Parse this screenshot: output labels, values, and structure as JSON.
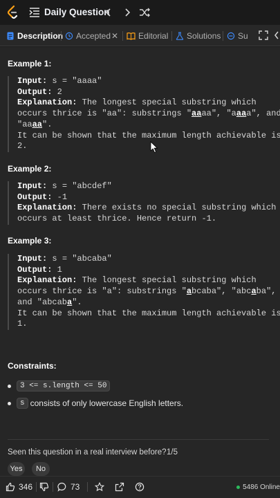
{
  "header": {
    "title": "Daily Question",
    "icons": [
      "leetcode-logo",
      "problem-list-icon",
      "prev-icon",
      "next-icon",
      "shuffle-icon"
    ]
  },
  "tabs": [
    {
      "label": "Description",
      "icon": "description-icon",
      "active": true
    },
    {
      "label": "Accepted",
      "icon": "history-icon",
      "active": false
    },
    {
      "label": "Editorial",
      "icon": "book-icon",
      "active": false
    },
    {
      "label": "Solutions",
      "icon": "flask-icon",
      "active": false
    },
    {
      "label": "Su",
      "icon": "submissions-icon",
      "active": false
    }
  ],
  "examples": [
    {
      "title": "Example 1:",
      "input_label": "Input:",
      "input": " s = \"aaaa\"",
      "output_label": "Output:",
      "output": " 2",
      "expl_label": "Explanation:",
      "expl_lines": [
        [
          "The longest special substring which"
        ],
        [
          "occurs thrice is \"aa\": substrings \"",
          "aa",
          "aa\", \"a",
          "aa",
          "a\", and"
        ],
        [
          "\"aa",
          "aa",
          "\"."
        ],
        [
          "It can be shown that the maximum length achievable is"
        ],
        [
          "2."
        ]
      ]
    },
    {
      "title": "Example 2:",
      "input_label": "Input:",
      "input": " s = \"abcdef\"",
      "output_label": "Output:",
      "output": " -1",
      "expl_label": "Explanation:",
      "expl_lines": [
        [
          "There exists no special substring which"
        ],
        [
          "occurs at least thrice. Hence return -1."
        ]
      ]
    },
    {
      "title": "Example 3:",
      "input_label": "Input:",
      "input": " s = \"abcaba\"",
      "output_label": "Output:",
      "output": " 1",
      "expl_label": "Explanation:",
      "expl_lines": [
        [
          "The longest special substring which"
        ],
        [
          "occurs thrice is \"a\": substrings \"",
          "a",
          "bcaba\", \"abc",
          "a",
          "ba\","
        ],
        [
          "and \"abcab",
          "a",
          "\"."
        ],
        [
          "It can be shown that the maximum length achievable is"
        ],
        [
          "1."
        ]
      ]
    }
  ],
  "constraints": {
    "title": "Constraints:",
    "items": [
      {
        "code": "3 <= s.length <= 50",
        "text": ""
      },
      {
        "code": "s",
        "text": "consists of only lowercase English letters."
      }
    ]
  },
  "interview": {
    "question": "Seen this question in a real interview before?",
    "count": "1/5",
    "yes": "Yes",
    "no": "No"
  },
  "footer": {
    "likes": "346",
    "comments": "73",
    "online": "5486 Online"
  }
}
